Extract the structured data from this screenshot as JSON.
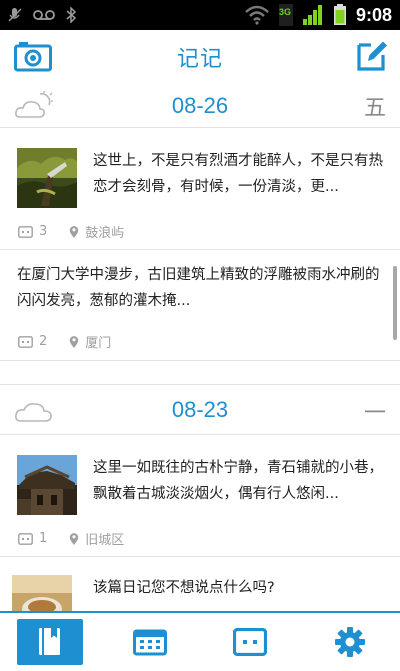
{
  "status_bar": {
    "time": "9:08",
    "network_label": "3G",
    "icons": [
      "mic-off-icon",
      "voicemail-icon",
      "bluetooth-icon",
      "wifi-icon",
      "signal-icon",
      "battery-icon"
    ]
  },
  "app_bar": {
    "title": "记记",
    "left_icon": "camera-icon",
    "right_icon": "compose-icon"
  },
  "days": [
    {
      "date": "08-26",
      "weekday": "五",
      "weather_icon": "partly-cloudy-icon",
      "entries": [
        {
          "text": "这世上，不是只有烈酒才能醉人，不是只有热恋才会刻骨，有时候，一份清淡，更...",
          "photo_count": "3",
          "location": "鼓浪屿",
          "has_thumb": true
        },
        {
          "text": "在厦门大学中漫步，古旧建筑上精致的浮雕被雨水冲刷的闪闪发亮，葱郁的灌木掩...",
          "photo_count": "2",
          "location": "厦门",
          "has_thumb": false
        }
      ]
    },
    {
      "date": "08-23",
      "weekday": "一",
      "weather_icon": "cloudy-icon",
      "entries": [
        {
          "text": "这里一如既往的古朴宁静，青石铺就的小巷，飘散着古城淡淡烟火，偶有行人悠闲...",
          "photo_count": "1",
          "location": "旧城区",
          "has_thumb": true
        },
        {
          "text": "该篇日记您不想说点什么吗?",
          "has_thumb": true
        }
      ]
    }
  ],
  "tab_bar": {
    "tabs": [
      {
        "icon": "diary-book-icon",
        "active": true
      },
      {
        "icon": "calendar-icon",
        "active": false
      },
      {
        "icon": "photo-frame-icon",
        "active": false
      },
      {
        "icon": "settings-gear-icon",
        "active": false
      }
    ]
  },
  "colors": {
    "accent": "#1e8fd0",
    "divider": "#e3e3e3",
    "meta_gray": "#a0a0a0"
  }
}
